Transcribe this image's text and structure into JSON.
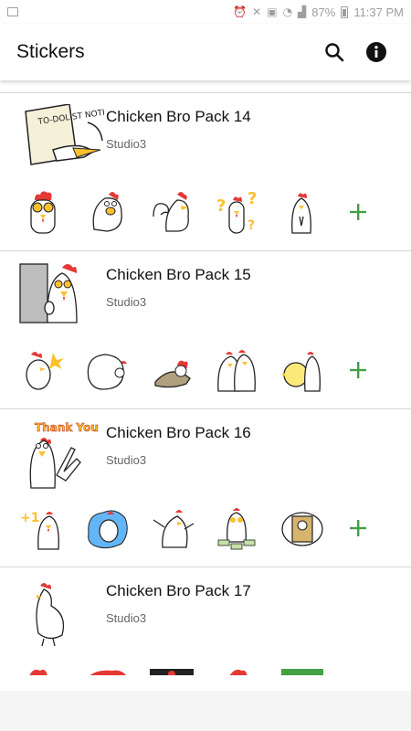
{
  "status_bar": {
    "battery": "87%",
    "time": "11:37 PM"
  },
  "app_bar": {
    "title": "Stickers",
    "search_icon": "search-icon",
    "info_icon": "info-icon"
  },
  "packs": [
    {
      "name": "Chicken Bro Pack 14",
      "author": "Studio3"
    },
    {
      "name": "Chicken Bro Pack 15",
      "author": "Studio3"
    },
    {
      "name": "Chicken Bro Pack 16",
      "author": "Studio3"
    },
    {
      "name": "Chicken Bro Pack 17",
      "author": "Studio3"
    }
  ],
  "thumb_texts": {
    "pack14_paper": "TO-DOLIST NOTHING",
    "pack16_banner": "Thank You",
    "pack16_plus_one": "+1"
  },
  "colors": {
    "accent_green": "#43a047",
    "comb_red": "#e53935",
    "beak_yellow": "#fbc02d"
  }
}
